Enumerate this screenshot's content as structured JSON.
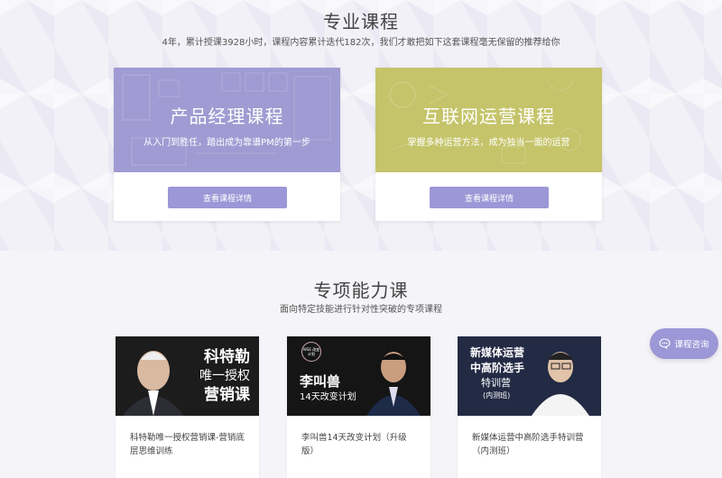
{
  "professional": {
    "title": "专业课程",
    "subtitle": "4年，累计授课3928小时，课程内容累计迭代182次，我们才敢把如下这套课程毫无保留的推荐给你",
    "courses": [
      {
        "title": "产品经理课程",
        "desc": "从入门到胜任，踏出成为靠谱PM的第一步",
        "button": "查看课程详情",
        "color": "#a09bd2"
      },
      {
        "title": "互联网运营课程",
        "desc": "掌握多种运营方法，成为独当一面的运营",
        "button": "查看课程详情",
        "color": "#c5c46a"
      }
    ]
  },
  "special": {
    "title": "专项能力课",
    "subtitle": "面向特定技能进行针对性突破的专项课程",
    "cards": [
      {
        "img_lines": [
          "科特勒",
          "唯一授权",
          "营销课"
        ],
        "desc": "科特勒唯一授权营销课-营销底层思维训练"
      },
      {
        "badge": "WSE 改变计划",
        "img_lines": [
          "李叫兽",
          "14天改变计划"
        ],
        "desc": "李叫兽14天改变计划（升级版）"
      },
      {
        "img_lines": [
          "新媒体运营",
          "中高阶选手",
          "特训营",
          "(内测班)"
        ],
        "desc": "新媒体运营中高阶选手特训营（内测班）"
      }
    ]
  },
  "consult": {
    "label": "课程咨询",
    "icon": "chat-icon"
  }
}
